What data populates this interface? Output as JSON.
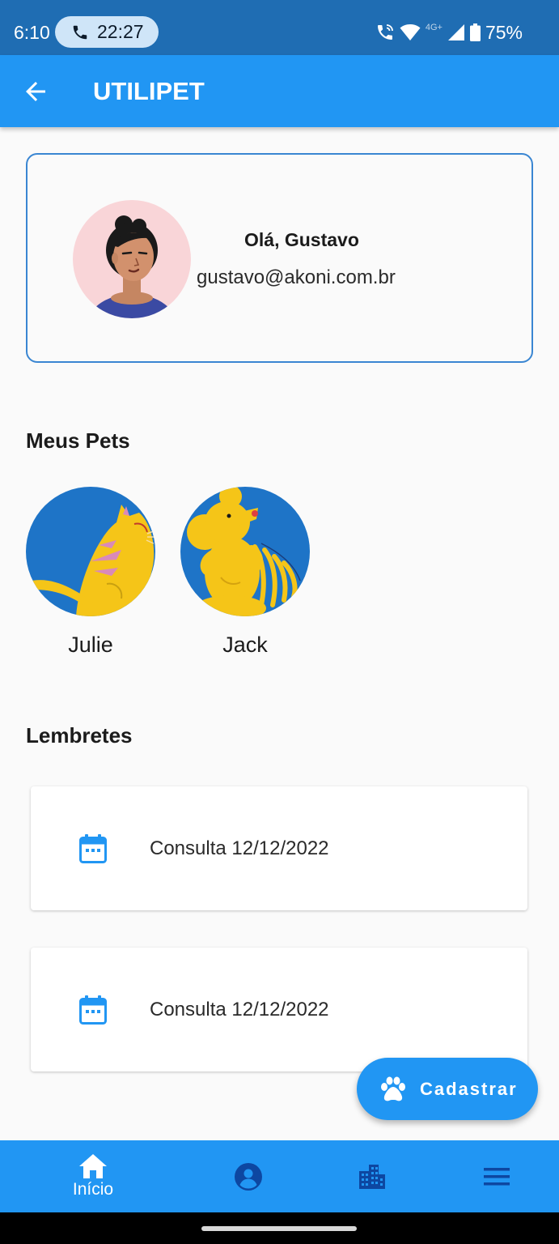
{
  "status_bar": {
    "time": "6:10",
    "call_time": "22:27",
    "network": "4G+",
    "battery": "75%"
  },
  "app_bar": {
    "title": "UTILIPET",
    "back_icon": "arrow-left-icon"
  },
  "profile": {
    "greeting": "Olá, Gustavo",
    "email": "gustavo@akoni.com.br",
    "avatar_icon": "user-avatar-illustration"
  },
  "pets_section": {
    "title": "Meus Pets",
    "pets": [
      {
        "name": "Julie",
        "icon": "cat-illustration"
      },
      {
        "name": "Jack",
        "icon": "dog-illustration"
      }
    ]
  },
  "reminders_section": {
    "title": "Lembretes",
    "items": [
      {
        "text": "Consulta 12/12/2022",
        "icon": "calendar-icon"
      },
      {
        "text": "Consulta 12/12/2022",
        "icon": "calendar-icon"
      }
    ]
  },
  "fab": {
    "label": "Cadastrar",
    "icon": "paw-icon"
  },
  "bottom_nav": {
    "items": [
      {
        "label": "Início",
        "icon": "home-icon",
        "active": true
      },
      {
        "label": "",
        "icon": "account-circle-icon",
        "active": false
      },
      {
        "label": "",
        "icon": "buildings-icon",
        "active": false
      },
      {
        "label": "",
        "icon": "menu-icon",
        "active": false
      }
    ]
  },
  "colors": {
    "status_bar": "#1f6db3",
    "primary": "#2196f3",
    "pet_circle": "#1e74c7",
    "pet_yellow": "#f5c518",
    "card_border": "#3a86d2",
    "background": "#fafafa"
  }
}
